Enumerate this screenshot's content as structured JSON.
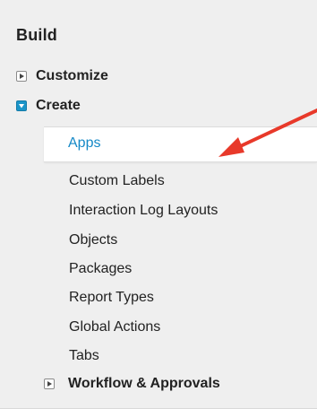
{
  "sidebar": {
    "title": "Build",
    "sections": [
      {
        "label": "Customize",
        "state": "collapsed"
      },
      {
        "label": "Create",
        "state": "expanded"
      }
    ],
    "create_items": [
      {
        "label": "Apps",
        "selected": true
      },
      {
        "label": "Custom Labels"
      },
      {
        "label": "Interaction Log Layouts"
      },
      {
        "label": "Objects"
      },
      {
        "label": "Packages"
      },
      {
        "label": "Report Types"
      },
      {
        "label": "Global Actions"
      },
      {
        "label": "Tabs"
      }
    ],
    "subsection": {
      "label": "Workflow & Approvals",
      "state": "collapsed"
    }
  },
  "colors": {
    "accent": "#1b95c9",
    "link": "#1589c7",
    "arrow": "#e8392a",
    "panel_bg": "#efefef"
  },
  "icons": {
    "collapsed": "triangle-right-icon",
    "expanded": "triangle-down-icon",
    "annotation": "red-arrow-icon"
  }
}
